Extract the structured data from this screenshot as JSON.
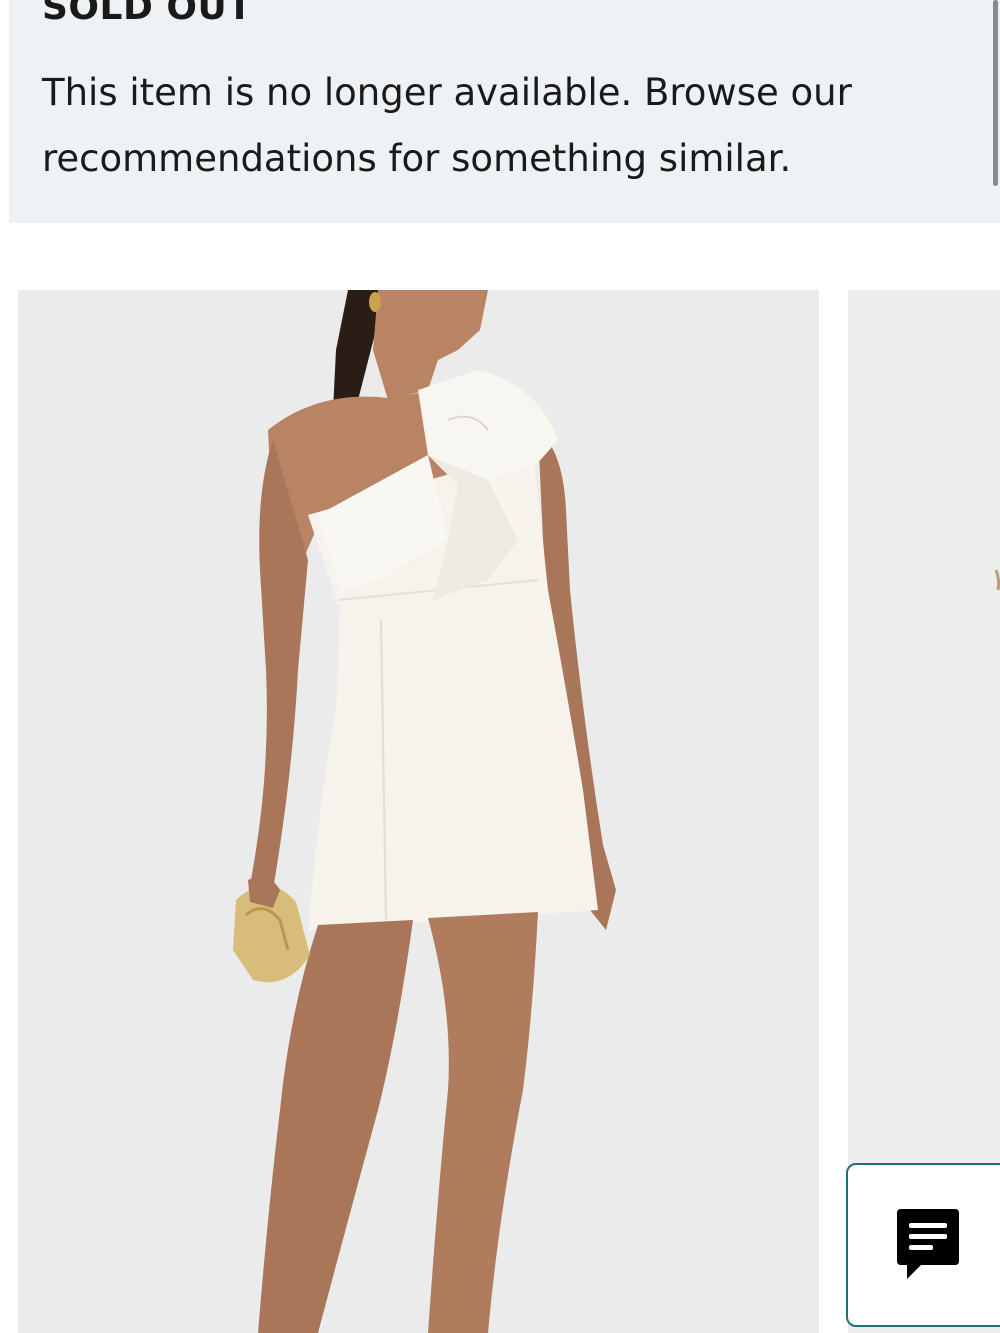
{
  "notice": {
    "title": "SOLD OUT",
    "message": "This item is no longer available. Browse our recommendations for something similar."
  },
  "carousel": {
    "items": [
      {
        "icon": "product-photo-white-one-shoulder-bow-mini-dress"
      },
      {
        "icon": "product-photo-partial"
      }
    ]
  },
  "chat": {
    "icon": "chat-bubble-icon"
  },
  "colors": {
    "notice_background": "#eef2f5",
    "image_background": "#ebebeb",
    "chat_border": "#1f6f7a",
    "text": "#1a1a1a"
  }
}
